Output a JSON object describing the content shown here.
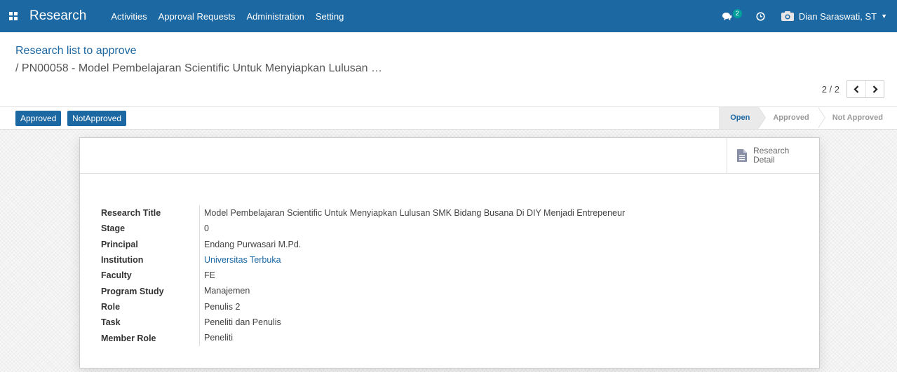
{
  "navbar": {
    "brand": "Research",
    "menu": [
      "Activities",
      "Approval Requests",
      "Administration",
      "Setting"
    ],
    "chat_count": "2",
    "user_name": "Dian Saraswati, ST"
  },
  "breadcrumb": {
    "parent": "Research list to approve",
    "current": "/ PN00058 - Model Pembelajaran Scientific Untuk Menyiapkan Lulusan …"
  },
  "pager": {
    "value": "2 / 2"
  },
  "statusbar": {
    "buttons": [
      "Approved",
      "NotApproved"
    ],
    "stages": [
      "Open",
      "Approved",
      "Not Approved"
    ],
    "active_stage": "Open"
  },
  "smart_button": {
    "line1": "Research",
    "line2": "Detail"
  },
  "fields": [
    {
      "label": "Research Title",
      "value": "Model Pembelajaran Scientific Untuk Menyiapkan Lulusan SMK Bidang Busana Di DIY Menjadi Entrepeneur"
    },
    {
      "label": "Stage",
      "value": "0"
    },
    {
      "label": "Principal",
      "value": "Endang Purwasari M.Pd."
    },
    {
      "label": "Institution",
      "value": "Universitas Terbuka"
    },
    {
      "label": "Faculty",
      "value": "FE"
    },
    {
      "label": "Program Study",
      "value": "Manajemen"
    },
    {
      "label": "Role",
      "value": "Penulis 2"
    },
    {
      "label": "Task",
      "value": "Peneliti dan Penulis"
    },
    {
      "label": "Member Role",
      "value": "Peneliti"
    }
  ],
  "colors": {
    "primary": "#1c68a3",
    "badge": "#00a09d"
  }
}
